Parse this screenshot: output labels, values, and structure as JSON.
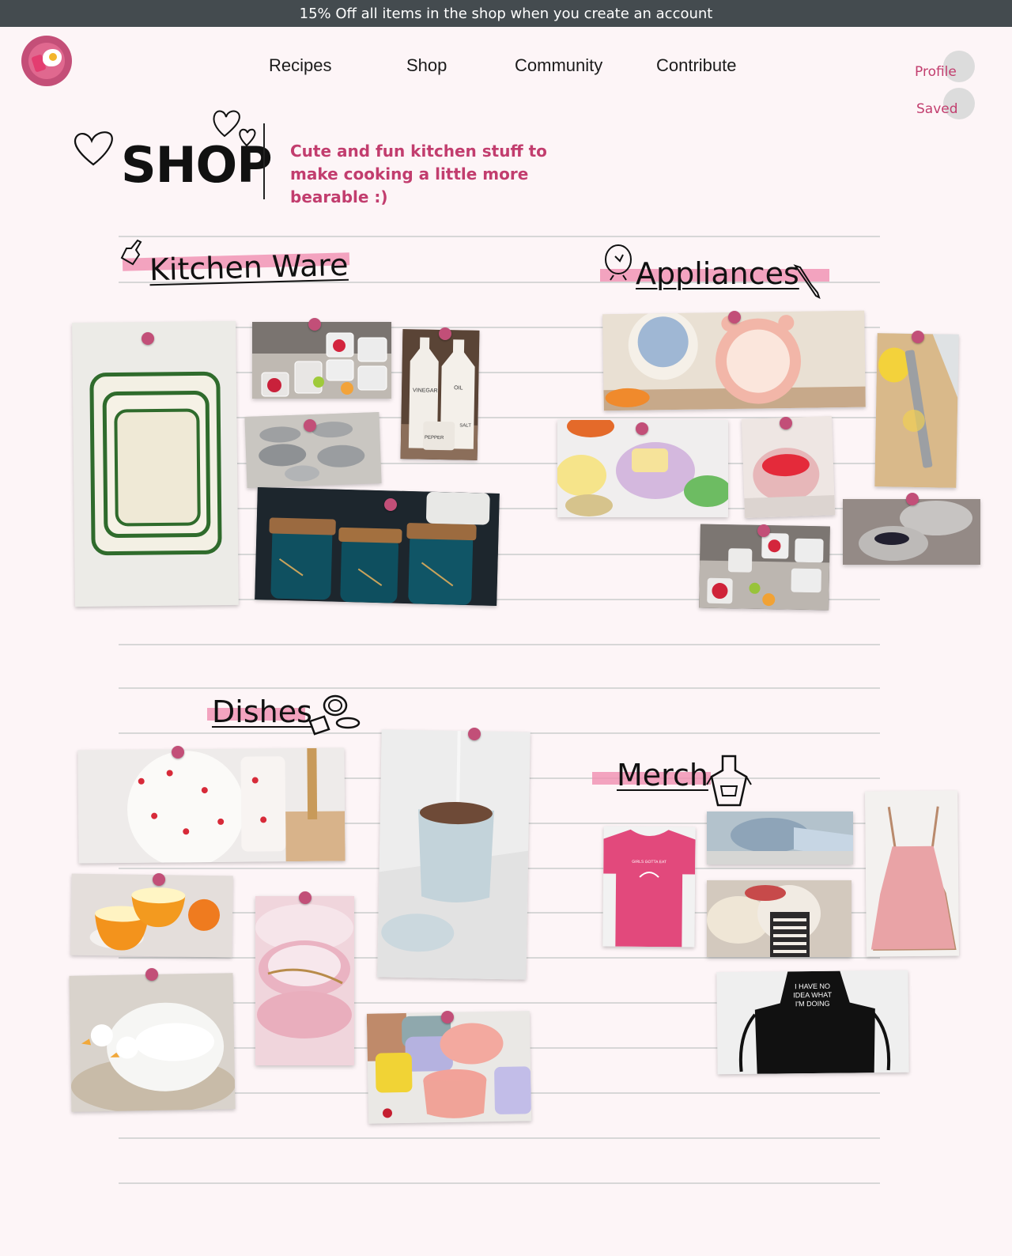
{
  "banner": {
    "text": "15% Off all items in the shop when you create an account"
  },
  "nav": {
    "items": [
      "Recipes",
      "Shop",
      "Community",
      "Contribute"
    ]
  },
  "account": {
    "profile": "Profile",
    "saved": "Saved"
  },
  "hero": {
    "title": "SHOP",
    "tagline": "Cute and fun kitchen stuff to make cooking a little more bearable :)"
  },
  "sections": {
    "kitchen_ware": "Kitchen Ware",
    "appliances": "Appliances",
    "dishes": "Dishes",
    "merch": "Merch"
  },
  "merch_text": {
    "tshirt": "GIRLS GOTTA EAT",
    "apron": "I HAVE NO IDEA WHAT I'M DOING"
  },
  "products": {
    "containers_labels": [
      "VINEGAR",
      "OIL",
      "PEPPER",
      "SALT"
    ]
  }
}
